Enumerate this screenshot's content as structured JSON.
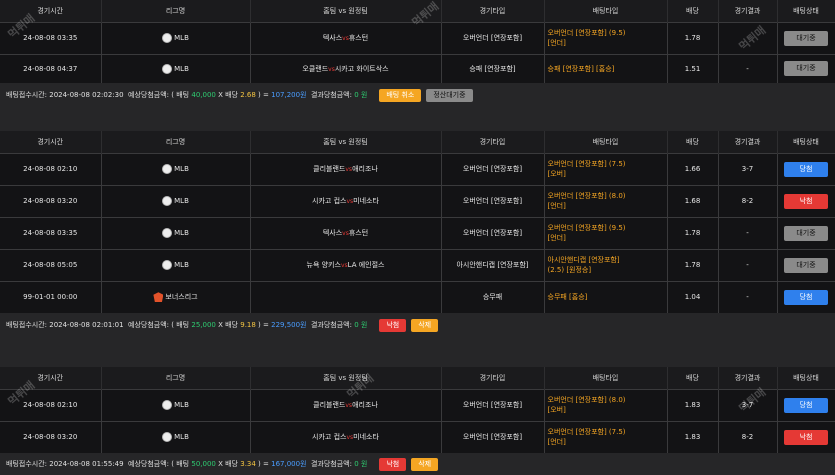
{
  "headers": [
    "경기시간",
    "리그명",
    "홈팀 vs 원정팀",
    "경기타입",
    "배팅타입",
    "배당",
    "경기결과",
    "배팅상태"
  ],
  "vs_glyph": "vs",
  "watermark": "먹튀매",
  "bets": [
    {
      "rows": [
        {
          "time": "24-08-08 03:35",
          "league": "MLB",
          "league_icon": "baseball-icon",
          "home": "텍사스",
          "away": "휴스턴",
          "game_type": "오버언더 [연장포함]",
          "bet_type": [
            "오버언더 [연장포함] (9.5)",
            "[언더]"
          ],
          "odds": "1.78",
          "result": "",
          "status": "대기중",
          "status_color": "gray"
        },
        {
          "time": "24-08-08 04:37",
          "league": "MLB",
          "league_icon": "baseball-icon",
          "home": "오클랜드",
          "away": "시카고 화이트삭스",
          "game_type": "승패 [연장포함]",
          "bet_type": [
            "승패 [연장포함] [홈승]"
          ],
          "odds": "1.51",
          "result": "-",
          "status": "대기중",
          "status_color": "gray"
        }
      ],
      "summary": {
        "label": "배팅접수시간:",
        "time": "2024-08-08 02:02:30",
        "expected_label": "예상당첨금액:",
        "stake_label": "배팅",
        "stake": "40,000",
        "odds_label": "배당",
        "odds": "2.68",
        "expected": "107,200원",
        "result_label": "결과당첨금액:",
        "result": "0 원"
      },
      "buttons": [
        {
          "label": "배팅 취소",
          "color": "orange"
        },
        {
          "label": "정산대기중",
          "color": "gray"
        }
      ]
    },
    {
      "rows": [
        {
          "time": "24-08-08 02:10",
          "league": "MLB",
          "league_icon": "baseball-icon",
          "home": "클리블랜드",
          "away": "애리조나",
          "game_type": "오버언더 [연장포함]",
          "bet_type": [
            "오버언더 [연장포함] (7.5)",
            "[오버]"
          ],
          "odds": "1.66",
          "result": "3-7",
          "status": "당첨",
          "status_color": "blue"
        },
        {
          "time": "24-08-08 03:20",
          "league": "MLB",
          "league_icon": "baseball-icon",
          "home": "시카고 컵스",
          "away": "미네소타",
          "game_type": "오버언더 [연장포함]",
          "bet_type": [
            "오버언더 [연장포함] (8.0)",
            "[언더]"
          ],
          "odds": "1.68",
          "result": "8-2",
          "status": "낙첨",
          "status_color": "red"
        },
        {
          "time": "24-08-08 03:35",
          "league": "MLB",
          "league_icon": "baseball-icon",
          "home": "텍사스",
          "away": "휴스턴",
          "game_type": "오버언더 [연장포함]",
          "bet_type": [
            "오버언더 [연장포함] (9.5)",
            "[언더]"
          ],
          "odds": "1.78",
          "result": "-",
          "status": "대기중",
          "status_color": "gray"
        },
        {
          "time": "24-08-08 05:05",
          "league": "MLB",
          "league_icon": "baseball-icon",
          "home": "뉴욕 양키스",
          "away": "LA 에인절스",
          "game_type": "아시안핸디캡 [연장포함]",
          "bet_type": [
            "아시안핸디캡 [연장포함]",
            "(2.5) [원정승]"
          ],
          "odds": "1.78",
          "result": "-",
          "status": "대기중",
          "status_color": "gray"
        },
        {
          "time": "99-01-01 00:00",
          "league": "보너스리그",
          "league_icon": "bonus-icon",
          "home": "",
          "away": "",
          "game_type": "승무패",
          "bet_type": [
            "승무패 [홈승]"
          ],
          "odds": "1.04",
          "result": "-",
          "status": "당첨",
          "status_color": "blue"
        }
      ],
      "summary": {
        "label": "배팅접수시간:",
        "time": "2024-08-08 02:01:01",
        "expected_label": "예상당첨금액:",
        "stake_label": "배팅",
        "stake": "25,000",
        "odds_label": "배당",
        "odds": "9.18",
        "expected": "229,500원",
        "result_label": "결과당첨금액:",
        "result": "0 원"
      },
      "buttons": [
        {
          "label": "낙첨",
          "color": "red"
        },
        {
          "label": "삭제",
          "color": "orange"
        }
      ]
    },
    {
      "rows": [
        {
          "time": "24-08-08 02:10",
          "league": "MLB",
          "league_icon": "baseball-icon",
          "home": "클리블랜드",
          "away": "애리조나",
          "game_type": "오버언더 [연장포함]",
          "bet_type": [
            "오버언더 [연장포함] (8.0)",
            "[오버]"
          ],
          "odds": "1.83",
          "result": "3-7",
          "status": "당첨",
          "status_color": "blue"
        },
        {
          "time": "24-08-08 03:20",
          "league": "MLB",
          "league_icon": "baseball-icon",
          "home": "시카고 컵스",
          "away": "미네소타",
          "game_type": "오버언더 [연장포함]",
          "bet_type": [
            "오버언더 [연장포함] (7.5)",
            "[언더]"
          ],
          "odds": "1.83",
          "result": "8-2",
          "status": "낙첨",
          "status_color": "red"
        }
      ],
      "summary": {
        "label": "배팅접수시간:",
        "time": "2024-08-08 01:55:49",
        "expected_label": "예상당첨금액:",
        "stake_label": "배팅",
        "stake": "50,000",
        "odds_label": "배당",
        "odds": "3.34",
        "expected": "167,000원",
        "result_label": "결과당첨금액:",
        "result": "0 원"
      },
      "buttons": [
        {
          "label": "낙첨",
          "color": "red"
        },
        {
          "label": "삭제",
          "color": "orange"
        }
      ]
    }
  ]
}
